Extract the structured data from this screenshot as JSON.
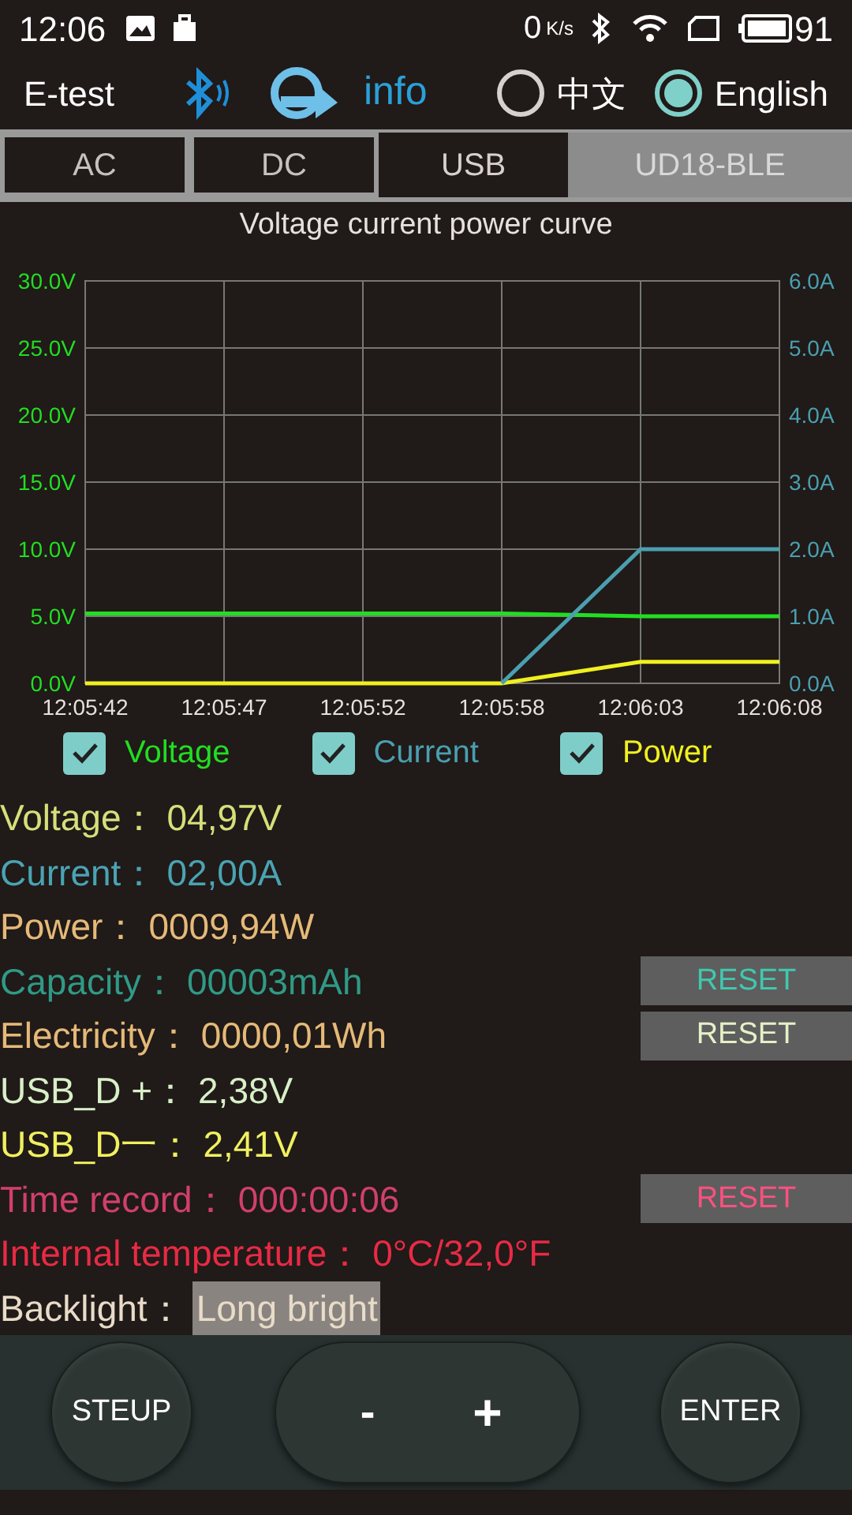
{
  "status_bar": {
    "time": "12:06",
    "speed": "0",
    "speed_unit": "K/s",
    "battery": "91"
  },
  "header": {
    "app_name": "E-test",
    "info": "info",
    "languages": [
      {
        "label": "中文",
        "selected": false
      },
      {
        "label": "English",
        "selected": true
      }
    ]
  },
  "tabs": [
    {
      "label": "AC",
      "selected": false
    },
    {
      "label": "DC",
      "selected": false
    },
    {
      "label": "USB",
      "selected": true
    }
  ],
  "device_button": "UD18-BLE",
  "chart": {
    "title": "Voltage current power curve",
    "chart_data": {
      "type": "line",
      "categories": [
        "12:05:42",
        "12:05:47",
        "12:05:52",
        "12:05:58",
        "12:06:03",
        "12:06:08"
      ],
      "ylim": [
        0,
        30
      ],
      "y2lim": [
        0,
        6
      ],
      "grid": true,
      "yticks": [
        {
          "value": 0,
          "label": "0.0V"
        },
        {
          "value": 5,
          "label": "5.0V"
        },
        {
          "value": 10,
          "label": "10.0V"
        },
        {
          "value": 15,
          "label": "15.0V"
        },
        {
          "value": 20,
          "label": "20.0V"
        },
        {
          "value": 25,
          "label": "25.0V"
        },
        {
          "value": 30,
          "label": "30.0V"
        }
      ],
      "y2ticks": [
        {
          "value": 0,
          "label": "0.0A"
        },
        {
          "value": 1,
          "label": "1.0A"
        },
        {
          "value": 2,
          "label": "2.0A"
        },
        {
          "value": 3,
          "label": "3.0A"
        },
        {
          "value": 4,
          "label": "4.0A"
        },
        {
          "value": 5,
          "label": "5.0A"
        },
        {
          "value": 6,
          "label": "6.0A"
        }
      ],
      "series": [
        {
          "name": "Voltage",
          "color": "#22dd22",
          "values": [
            5.2,
            5.2,
            5.2,
            5.2,
            5.0,
            5.0
          ]
        },
        {
          "name": "Power",
          "color": "#f0f020",
          "values": [
            0,
            0,
            0,
            0,
            1.6,
            1.6
          ]
        },
        {
          "name": "Current",
          "color": "#4a9fb0",
          "axis": "y2",
          "values": [
            null,
            null,
            null,
            0,
            2.0,
            2.0
          ]
        }
      ]
    }
  },
  "legend": [
    {
      "checked": true
    },
    {
      "checked": true
    },
    {
      "checked": true
    }
  ],
  "readings": [
    {
      "label": "Voltage：",
      "value": "04,97V",
      "color": "#d4e07a"
    },
    {
      "label": "Current：",
      "value": "02,00A",
      "color": "#4aa3b3"
    },
    {
      "label": "Power：",
      "value": "0009,94W",
      "color": "#e5b978"
    },
    {
      "label": "Capacity：",
      "value": "00003mAh",
      "color": "#2f9a86",
      "reset": {
        "label": "RESET",
        "color": "#40c8ae"
      }
    },
    {
      "label": "Electricity：",
      "value": "0000,01Wh",
      "color": "#e5b978",
      "reset": {
        "label": "RESET",
        "color": "#e6f0c8"
      }
    },
    {
      "label": "USB_D +：",
      "value": "2,38V",
      "color": "#d8f0c8"
    },
    {
      "label": "USB_D一：",
      "value": "2,41V",
      "color": "#f0f060"
    },
    {
      "label": "Time record：",
      "value": "000:00:06",
      "color": "#d0406a",
      "reset": {
        "label": "RESET",
        "color": "#ff5080"
      }
    },
    {
      "label": "Internal temperature：",
      "value": "0°C/32,0°F",
      "color": "#e82a45"
    },
    {
      "label": "Backlight：",
      "value": "Long bright",
      "color": "#e8dcc8",
      "highlighted": true
    }
  ],
  "controls": {
    "setup": "STEUP",
    "minus": "-",
    "plus": "+",
    "enter": "ENTER"
  }
}
